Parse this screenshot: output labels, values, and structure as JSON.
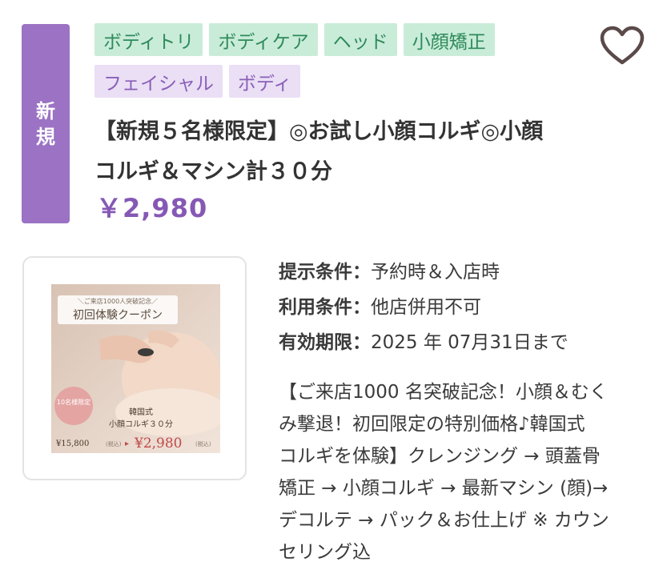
{
  "badge": {
    "text": "新規"
  },
  "tags": {
    "row1": [
      "ボディトリ",
      "ボディケア",
      "ヘッド",
      "小顔矯正"
    ],
    "row2": [
      "フェイシャル",
      "ボディ"
    ]
  },
  "favorite": {
    "icon": "heart-outline-icon"
  },
  "coupon": {
    "title_line1": "【新規５名様限定】◎お試し小顔コルギ◎小顔",
    "title_line2": "コルギ＆マシン計３０分",
    "price": "￥2,980"
  },
  "thumbnail": {
    "banner_top": "＼ご来店1000人突破記念／",
    "banner_main": "初回体験クーポン",
    "circle_text": "10名様限定",
    "course_line1": "韓国式",
    "course_line2": "小顔コルギ３０分",
    "old_price": "¥15,800",
    "new_price": "¥2,980",
    "tax_note": "(税込)"
  },
  "conditions": [
    {
      "label": "提示条件：",
      "value": "予約時＆入店時"
    },
    {
      "label": "利用条件：",
      "value": "他店併用不可"
    },
    {
      "label": "有効期限：",
      "value": "2025 年 07月31日まで"
    }
  ],
  "description": {
    "line1": "【ご来店1000 名突破記念！小顔＆むく",
    "line2": "み撃退！初回限定の特別価格♪韓国式",
    "line3": "コルギを体験】クレンジング → 頭蓋骨",
    "line4": "矯正 → 小顔コルギ → 最新マシン (顔)→",
    "line5": "デコルテ → パック＆お仕上げ ※ カウン",
    "line6": "セリング込"
  },
  "colors": {
    "accent_purple": "#8658b5",
    "badge_purple": "#9b72c4",
    "tag_green_bg": "#c9ecd9",
    "tag_purple_bg": "#eadff5"
  }
}
